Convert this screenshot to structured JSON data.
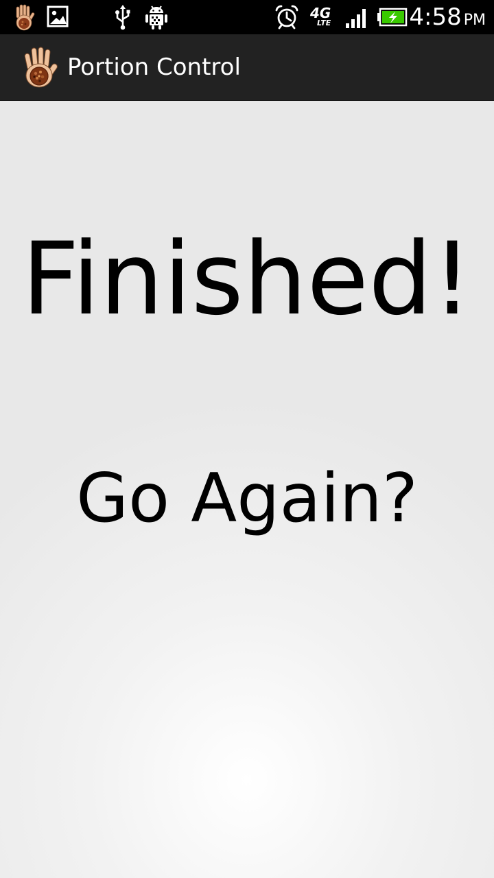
{
  "status_bar": {
    "time": "4:58",
    "ampm": "PM",
    "network_label": "4G",
    "network_sublabel": "LTE",
    "icons": [
      "app-hand-icon",
      "gallery-icon",
      "usb-icon",
      "android-debug-icon",
      "alarm-icon",
      "4g-lte-icon",
      "signal-icon",
      "battery-charging-icon"
    ],
    "battery_color": "#39c900"
  },
  "action_bar": {
    "title": "Portion Control",
    "background": "#222222"
  },
  "main": {
    "heading": "Finished!",
    "go_again_label": "Go Again?"
  }
}
